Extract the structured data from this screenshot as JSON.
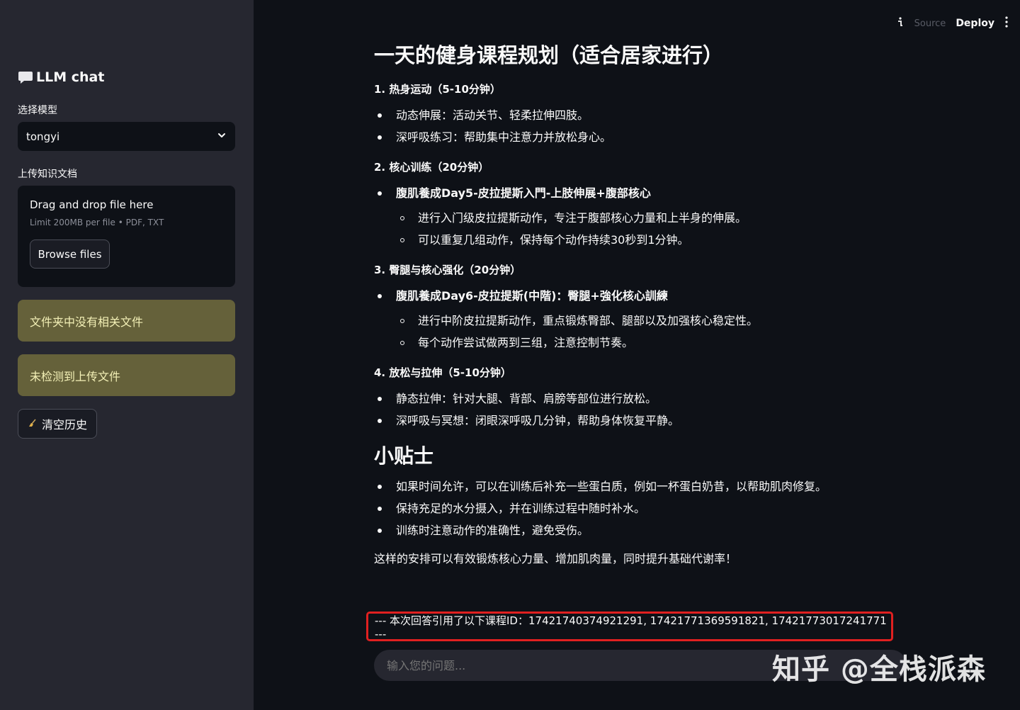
{
  "sidebar": {
    "title": "LLM chat",
    "model_label": "选择模型",
    "model_value": "tongyi",
    "upload_label": "上传知识文档",
    "upload_title": "Drag and drop file here",
    "upload_limit": "Limit 200MB per file • PDF, TXT",
    "browse_label": "Browse files",
    "warning_1": "文件夹中没有相关文件",
    "warning_2": "未检测到上传文件",
    "clear_label": "清空历史"
  },
  "header": {
    "source_text": "Source",
    "deploy_label": "Deploy"
  },
  "main": {
    "title": "一天的健身课程规划（适合居家进行）",
    "s1": "1. 热身运动（5-10分钟）",
    "s1_items": [
      "动态伸展：活动关节、轻柔拉伸四肢。",
      "深呼吸练习：帮助集中注意力并放松身心。"
    ],
    "s2": "2. 核心训练（20分钟）",
    "s2_bold": "腹肌養成Day5-皮拉提斯入門-上肢伸展+腹部核心",
    "s2_sub": [
      "进行入门级皮拉提斯动作，专注于腹部核心力量和上半身的伸展。",
      "可以重复几组动作，保持每个动作持续30秒到1分钟。"
    ],
    "s3": "3. 臀腿与核心强化（20分钟）",
    "s3_bold": "腹肌養成Day6-皮拉提斯(中階)：臀腿+強化核心訓練",
    "s3_sub": [
      "进行中阶皮拉提斯动作，重点锻炼臀部、腿部以及加强核心稳定性。",
      "每个动作尝试做两到三组，注意控制节奏。"
    ],
    "s4": "4. 放松与拉伸（5-10分钟）",
    "s4_items": [
      "静态拉伸：针对大腿、背部、肩膀等部位进行放松。",
      "深呼吸与冥想：闭眼深呼吸几分钟，帮助身体恢复平静。"
    ],
    "tips_title": "小贴士",
    "tips": [
      "如果时间允许，可以在训练后补充一些蛋白质，例如一杯蛋白奶昔，以帮助肌肉修复。",
      "保持充足的水分摄入，并在训练过程中随时补水。",
      "训练时注意动作的准确性，避免受伤。"
    ],
    "summary": "这样的安排可以有效锻炼核心力量、增加肌肉量，同时提升基础代谢率！",
    "reference": "--- 本次回答引用了以下课程ID：17421740374921291, 17421771369591821, 17421773017241771 ---"
  },
  "chat": {
    "placeholder": "输入您的问题..."
  },
  "watermark": "知乎 @全栈派森",
  "colors": {
    "background": "#0e1117",
    "sidebar": "#262730",
    "warning": "#65613a",
    "highlight_border": "#e02020"
  }
}
